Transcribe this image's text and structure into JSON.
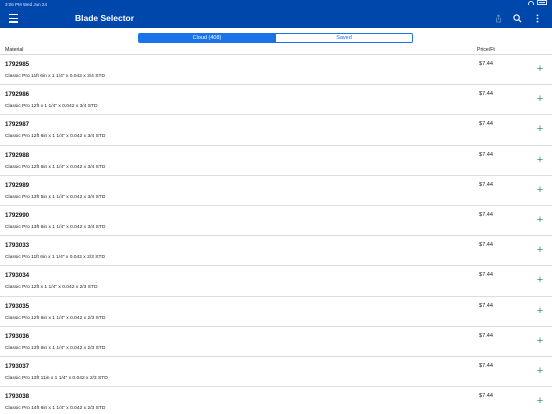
{
  "status_bar": {
    "time_date": "3:06 PM   Wed Jun 24"
  },
  "nav": {
    "title": "Blade Selector"
  },
  "segments": {
    "cloud": "Cloud (408)",
    "saved": "Saved"
  },
  "columns": {
    "material": "Material",
    "price": "Price/Ft"
  },
  "colors": {
    "nav_bg": "#0047ab",
    "accent": "#1a73e8",
    "add_green": "#2e9e5b"
  },
  "rows": [
    {
      "id": "1792985",
      "desc": "Classic Pro 11ft 6in x 1 1/4\" x 0.042 x 3/4 STD",
      "price": "$7.44"
    },
    {
      "id": "1792986",
      "desc": "Classic Pro 12ft x 1 1/4\" x 0.042 x 3/4 STD",
      "price": "$7.44"
    },
    {
      "id": "1792987",
      "desc": "Classic Pro 12ft 6in x 1 1/4\" x 0.042 x 3/4 STD",
      "price": "$7.44"
    },
    {
      "id": "1792988",
      "desc": "Classic Pro 12ft 6in x 1 1/4\" x 0.042 x 3/4 STD",
      "price": "$7.44"
    },
    {
      "id": "1792989",
      "desc": "Classic Pro 13ft 5in x 1 1/4\" x 0.042 x 3/4 STD",
      "price": "$7.44"
    },
    {
      "id": "1792990",
      "desc": "Classic Pro 13ft 6in x 1 1/4\" x 0.042 x 3/4 STD",
      "price": "$7.44"
    },
    {
      "id": "1793033",
      "desc": "Classic Pro 11ft 6in x 1 1/4\" x 0.042 x 2/3 STD",
      "price": "$7.44"
    },
    {
      "id": "1793034",
      "desc": "Classic Pro 12ft x 1 1/4\" x 0.042 x 2/3 STD",
      "price": "$7.44"
    },
    {
      "id": "1793035",
      "desc": "Classic Pro 12ft 6in x 1 1/4\" x 0.042 x 2/3 STD",
      "price": "$7.44"
    },
    {
      "id": "1793036",
      "desc": "Classic Pro 13ft 6in x 1 1/4\" x 0.042 x 2/3 STD",
      "price": "$7.44"
    },
    {
      "id": "1793037",
      "desc": "Classic Pro 13ft 11in x 1 1/4\" x 0.042 x 2/3 STD",
      "price": "$7.44"
    },
    {
      "id": "1793038",
      "desc": "Classic Pro 14ft 6in x 1 1/4\" x 0.042 x 2/3 STD",
      "price": "$7.44"
    }
  ]
}
